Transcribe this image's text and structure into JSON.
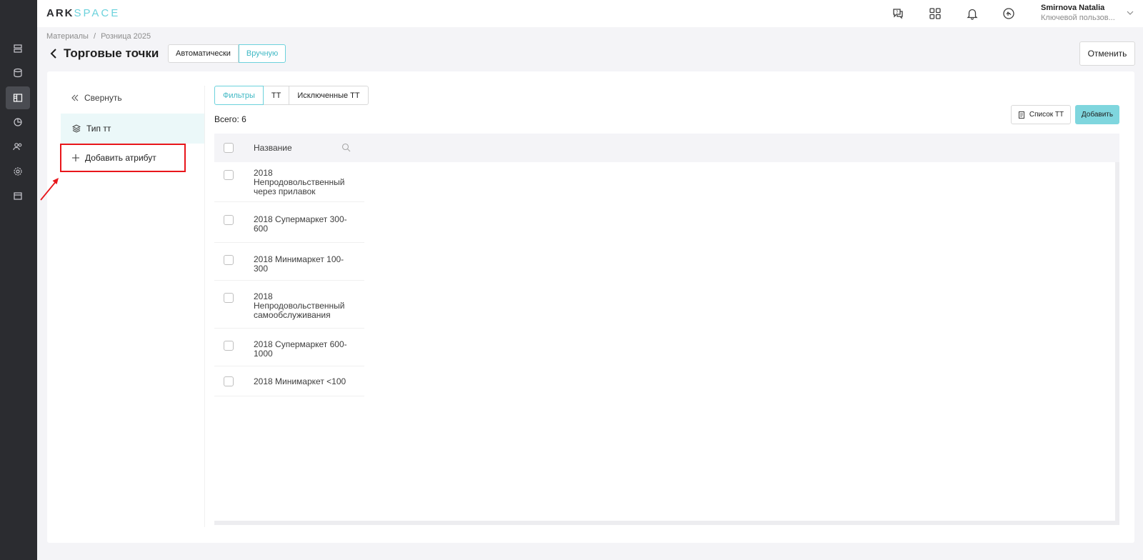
{
  "topbar": {
    "logo_ark": "ARK",
    "logo_space": "SPACE",
    "user_name": "Smirnova Natalia",
    "user_role": "Ключевой пользов..."
  },
  "breadcrumb": [
    "Материалы",
    "/",
    "Розница 2025"
  ],
  "page_title": "Торговые точки",
  "mode": {
    "auto": "Автоматически",
    "manual": "Вручную",
    "selected": "Вручную"
  },
  "cancel_label": "Отменить",
  "sidebar": {
    "collapse": "Свернуть",
    "type_item": "Тип тт",
    "add_attribute": "Добавить атрибут"
  },
  "tabs": [
    "Фильтры",
    "ТТ",
    "Исключенные ТТ"
  ],
  "total": "Всего: 6",
  "actions": {
    "list": "Список ТТ",
    "add": "Добавить"
  },
  "table": {
    "column_name": "Название",
    "rows": [
      "2018 Непродовольственный через прилавок",
      "2018 Супермаркет 300-600",
      "2018 Минимаркет 100-300",
      "2018 Непродовольственный самообслуживания",
      "2018 Супермаркет 600-1000",
      "2018 Минимаркет <100"
    ]
  },
  "colors": {
    "accent": "#6cd2dc",
    "highlight": "#e8161b",
    "rail": "#2b2c30"
  }
}
